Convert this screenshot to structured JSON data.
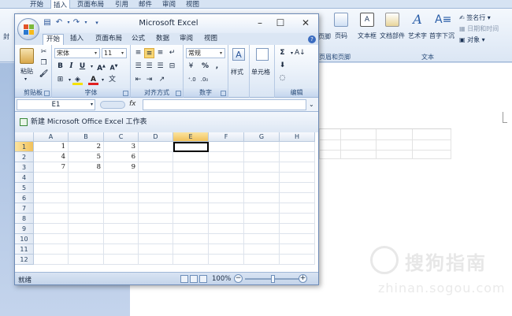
{
  "word": {
    "tabs": [
      "开始",
      "插入",
      "页面布局",
      "引用",
      "邮件",
      "审阅",
      "视图"
    ],
    "active_tab": "插入",
    "ribbon": {
      "cover_label": "封",
      "header_partial": "页脚",
      "page_number": "页码",
      "textbox": "文本框",
      "quick_parts": "文档部件",
      "wordart": "艺术字",
      "dropcap": "首字下沉",
      "signature": "签名行",
      "datetime": "日期和时间",
      "object": "对象",
      "group_header_footer": "页眉和页脚",
      "group_text": "文本"
    },
    "watermark": {
      "brand": "搜狗指南",
      "url": "zhinan.sogou.com"
    }
  },
  "excel": {
    "title": "Microsoft Excel",
    "tabs": [
      "开始",
      "插入",
      "页面布局",
      "公式",
      "数据",
      "审阅",
      "视图"
    ],
    "active_tab": "开始",
    "ribbon": {
      "paste": "粘贴",
      "font_name": "宋体",
      "font_size": "11",
      "number_format": "常规",
      "styles": "样式",
      "cells": "单元格",
      "group_clipboard": "剪贴板",
      "group_font": "字体",
      "group_alignment": "对齐方式",
      "group_number": "数字",
      "group_editing": "编辑"
    },
    "namebox": "E1",
    "fx_label": "fx",
    "workbook_title": "新建 Microsoft Office Excel 工作表",
    "columns": [
      "A",
      "B",
      "C",
      "D",
      "E",
      "F",
      "G",
      "H"
    ],
    "selected_column": "E",
    "rows": [
      {
        "num": "1",
        "cells": [
          "1",
          "2",
          "3"
        ]
      },
      {
        "num": "2",
        "cells": [
          "4",
          "5",
          "6"
        ]
      },
      {
        "num": "3",
        "cells": [
          "7",
          "8",
          "9"
        ]
      },
      {
        "num": "4",
        "cells": []
      },
      {
        "num": "5",
        "cells": []
      },
      {
        "num": "6",
        "cells": []
      },
      {
        "num": "7",
        "cells": []
      },
      {
        "num": "8",
        "cells": []
      },
      {
        "num": "9",
        "cells": []
      },
      {
        "num": "10",
        "cells": []
      },
      {
        "num": "11",
        "cells": []
      },
      {
        "num": "12",
        "cells": []
      }
    ],
    "status": "就绪",
    "zoom": "100%",
    "zoom_level": 1.0
  },
  "colors": {
    "selection": "#f1c15b",
    "ribbon_blue": "#dbe6f4",
    "frame": "#6d8bb7"
  }
}
